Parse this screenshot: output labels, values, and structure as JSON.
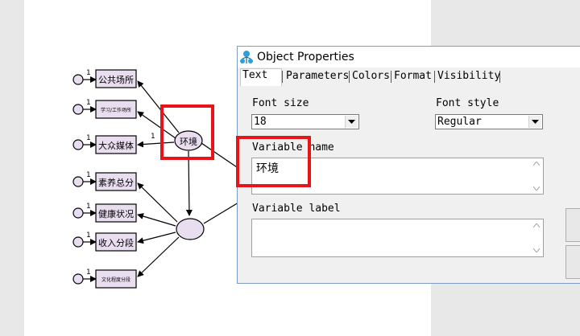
{
  "diagram": {
    "observed": [
      "公共场所",
      "学习/工作场所",
      "大众媒体",
      "素养总分",
      "健康状况",
      "收入分段",
      "文化程度分段"
    ],
    "latent_top": "环境",
    "path_labels": [
      "1",
      "1",
      "1",
      "1",
      "1",
      "1",
      "1",
      "1"
    ]
  },
  "dialog": {
    "title": "Object Properties",
    "tabs": [
      "Text",
      "Parameters",
      "Colors",
      "Format",
      "Visibility"
    ],
    "active_tab": "Text",
    "font_size_label": "Font size",
    "font_size_value": "18",
    "font_style_label": "Font style",
    "font_style_value": "Regular",
    "variable_name_label": "Variable name",
    "variable_name_value": "环境",
    "variable_label_label": "Variable label",
    "variable_label_value": ""
  },
  "colors": {
    "highlight": "#e8141b",
    "node_fill": "#e9def0",
    "dialog_border": "#7a9cc6"
  }
}
